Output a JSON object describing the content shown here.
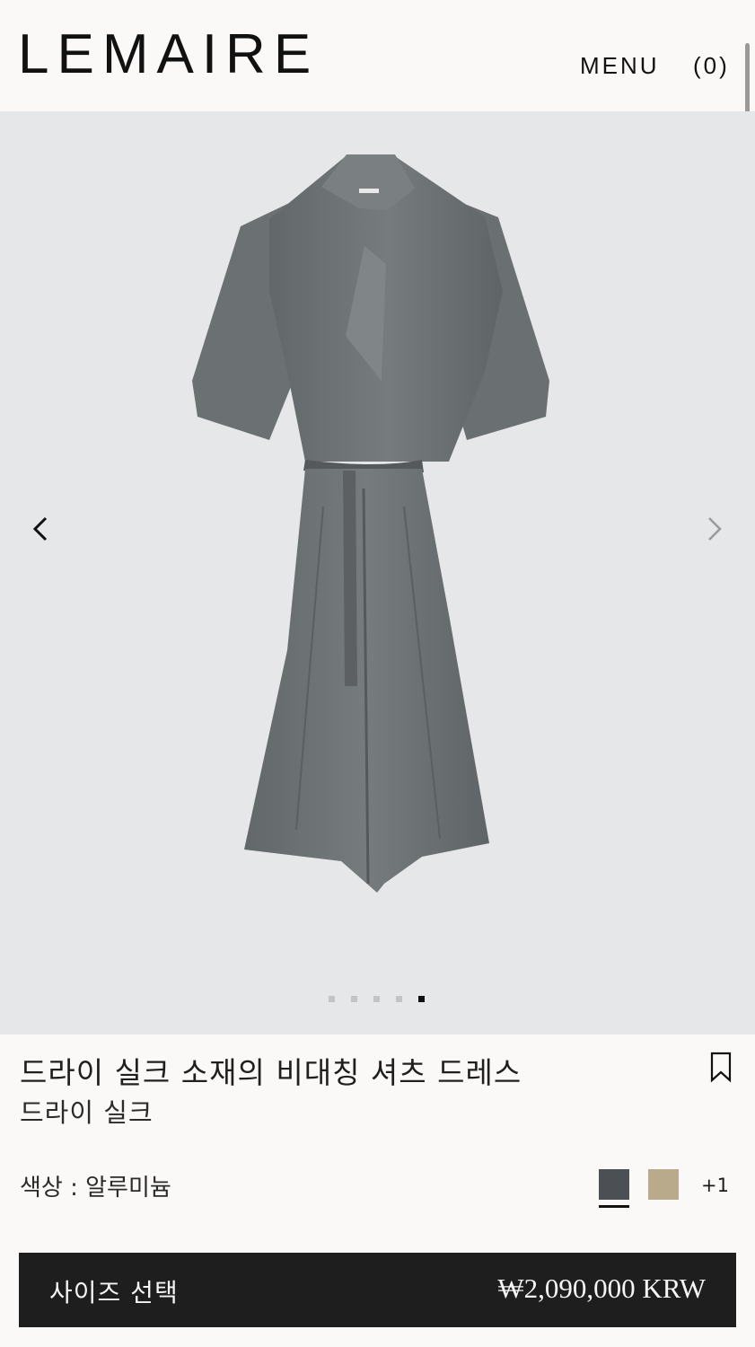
{
  "header": {
    "logo": "LEMAIRE",
    "menu_label": "MENU",
    "cart_count": "(0)"
  },
  "gallery": {
    "image_alt": "dress",
    "slide_count": 5,
    "active_index": 4
  },
  "product": {
    "title": "드라이 실크 소재의 비대칭 셔츠 드레스",
    "material": "드라이 실크",
    "color_label": "색상 : 알루미늄",
    "swatches": [
      "#4c5055",
      "#b8aa8a"
    ],
    "more_colors": "+1",
    "size_button_label": "사이즈 선택",
    "price": "₩2,090,000 KRW"
  },
  "colors": {
    "background": "#faf9f7",
    "gallery_bg": "#e6e7e9",
    "dress": "#6f7477",
    "cta_bg": "#1e1e1e"
  }
}
